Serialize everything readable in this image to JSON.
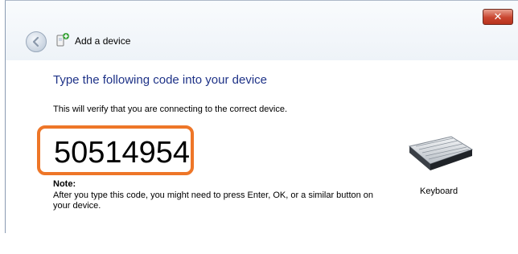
{
  "window": {
    "title": "Add a device",
    "close_glyph": "✕",
    "back_icon": "back-arrow-icon",
    "title_icon": "add-device-icon"
  },
  "main": {
    "heading": "Type the following code into your device",
    "description": "This will verify that you are connecting to the correct device.",
    "code": "50514954",
    "note_label": "Note:",
    "note_text": "After you type this code, you might need to press Enter, OK, or a similar button on your device."
  },
  "device": {
    "icon": "keyboard-icon",
    "label": "Keyboard"
  },
  "colors": {
    "heading": "#1e3287",
    "highlight_border": "#ee7628",
    "close_button": "#c9452f"
  }
}
